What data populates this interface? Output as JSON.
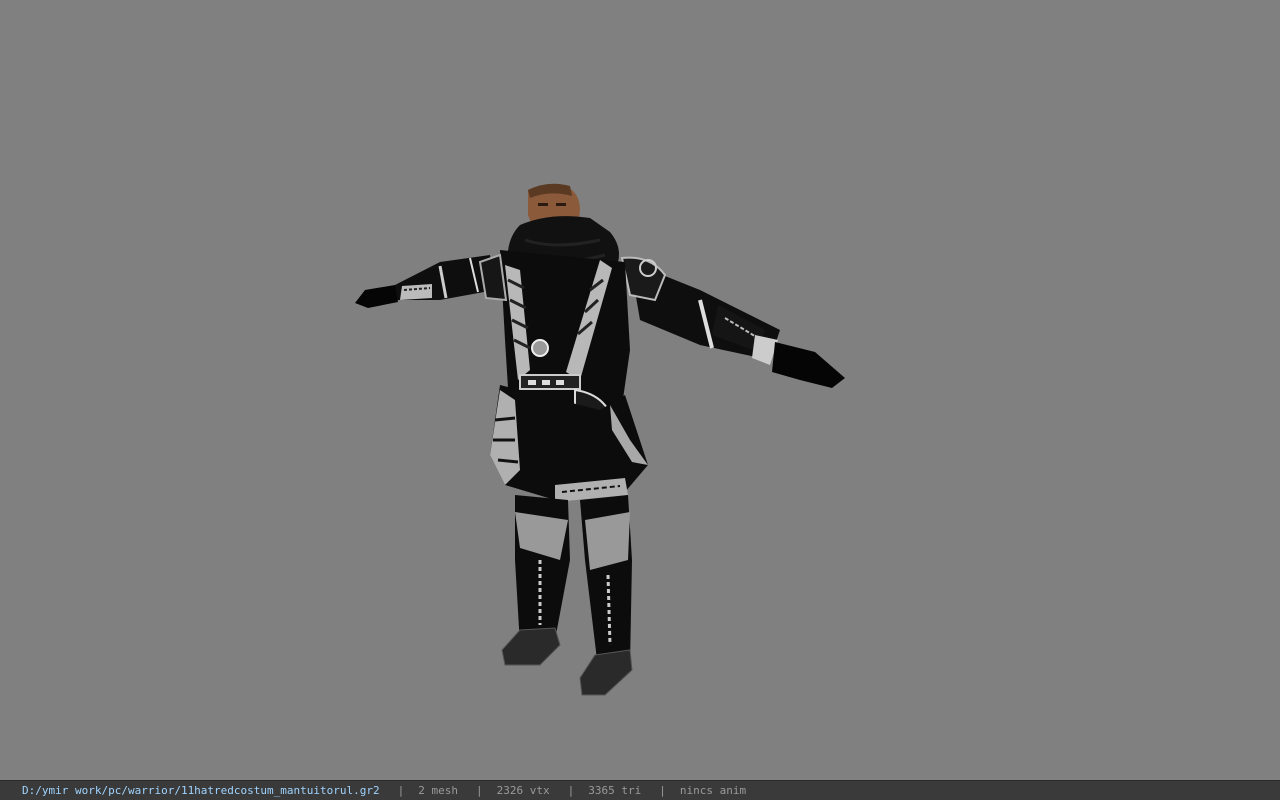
{
  "viewer": {
    "background_color": "#808080",
    "model_icon": "armored-warrior-character-model"
  },
  "status_bar": {
    "file_path": "D:/ymir work/pc/warrior/11hatredcostum_mantuitorul.gr2",
    "separator": "|",
    "mesh_count": "2 mesh",
    "vertex_count": "2326 vtx",
    "triangle_count": "3365 tri",
    "animation": "nincs anim",
    "path_color": "#9fd3ff",
    "text_color": "#9a9a9a"
  }
}
